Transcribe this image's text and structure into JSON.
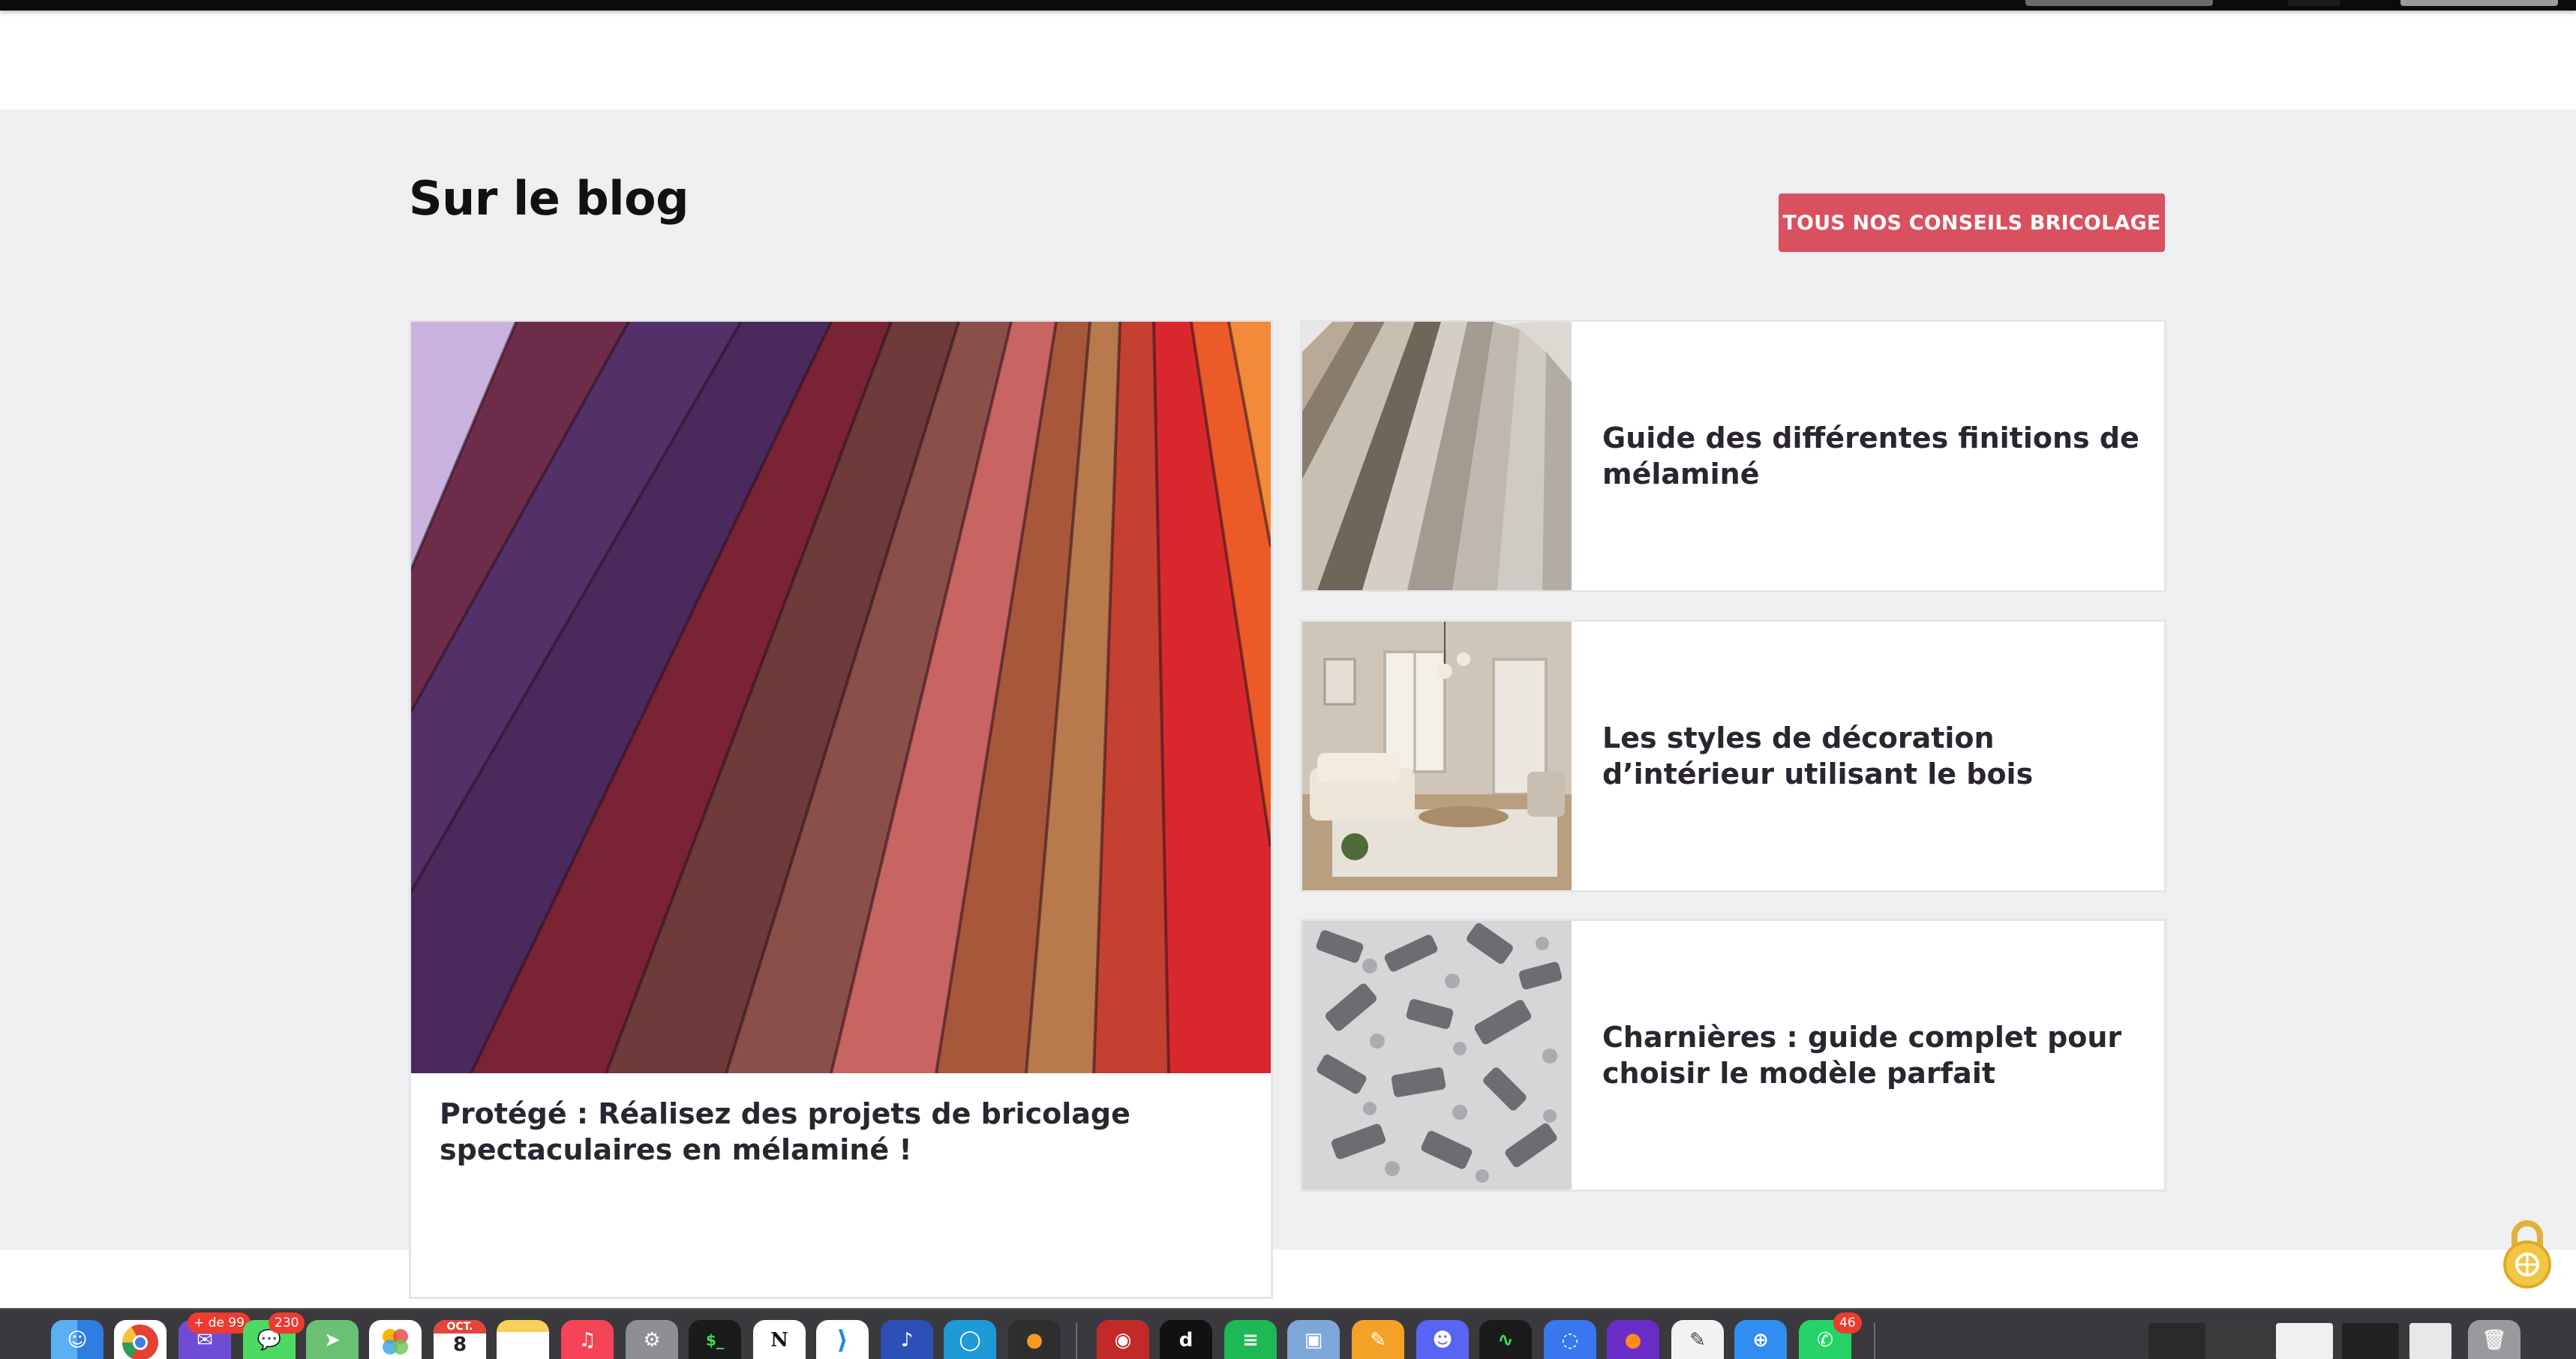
{
  "blog": {
    "title": "Sur le blog",
    "cta_label": "TOUS NOS CONSEILS BRICOLAGE",
    "featured": {
      "title": "Protégé : Réalisez des projets de bricolage spectaculaires en mélaminé !",
      "image": "melamine-color-samples-fan"
    },
    "posts": [
      {
        "title": "Guide des différentes finitions de mélaminé",
        "image": "wood-finish-samples-fan"
      },
      {
        "title": "Les styles de décoration d’intérieur utilisant le bois",
        "image": "living-room-interior"
      },
      {
        "title": "Charnières : guide complet pour choisir le modèle parfait",
        "image": "hinges-assortment"
      }
    ]
  },
  "colors": {
    "accent": "#d9505f",
    "section_bg": "#eeeff1",
    "card_border": "#e4e5e8"
  },
  "dock": {
    "badges": {
      "mail": "+ de 99",
      "messages": "230",
      "whatsapp": "46"
    },
    "calendar": {
      "month": "OCT.",
      "day": "8"
    },
    "icons": [
      "finder-icon",
      "chrome-icon",
      "mail-icon",
      "messages-icon",
      "maps-icon",
      "photos-icon",
      "calendar-icon",
      "notes-icon",
      "music-icon",
      "system-settings-icon",
      "terminal-icon",
      "notion-icon",
      "vscode-icon",
      "audio-app-icon",
      "cortana-icon",
      "squash-icon",
      "podcast-app-icon",
      "deezer-icon",
      "spotify-icon",
      "preview-icon",
      "pages-icon",
      "discord-icon",
      "activity-monitor-icon",
      "signal-icon",
      "firefox-icon",
      "textedit-icon",
      "safari-icon",
      "whatsapp-icon",
      "trash-icon"
    ]
  }
}
